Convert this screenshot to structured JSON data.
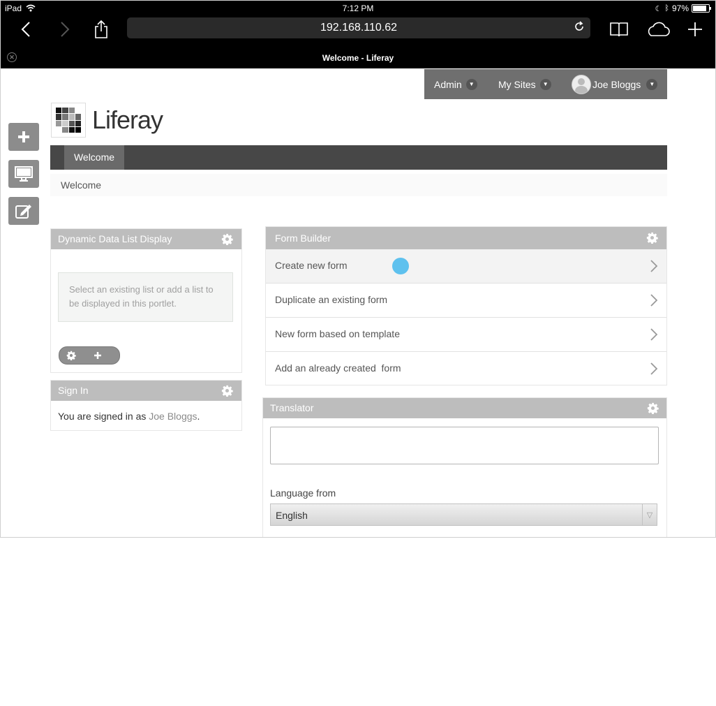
{
  "status": {
    "device": "iPad",
    "time": "7:12 PM",
    "battery": "97%"
  },
  "browser": {
    "url": "192.168.110.62",
    "tab_title": "Welcome - Liferay"
  },
  "dockbar": {
    "admin": "Admin",
    "my_sites": "My Sites",
    "user": "Joe Bloggs"
  },
  "site": {
    "name": "Liferay"
  },
  "nav": {
    "tabs": [
      {
        "label": "Welcome"
      }
    ]
  },
  "breadcrumb": {
    "current": "Welcome"
  },
  "ddl": {
    "title": "Dynamic Data List Display",
    "message": "Select an existing list or add a list to be displayed in this portlet."
  },
  "signin": {
    "title": "Sign In",
    "prefix": "You are signed in as ",
    "user": "Joe Bloggs",
    "suffix": "."
  },
  "form_builder": {
    "title": "Form Builder",
    "items": [
      {
        "label": "Create new form"
      },
      {
        "label": "Duplicate an existing form"
      },
      {
        "label": "New form based on template"
      },
      {
        "label": "Add an already created  form"
      }
    ]
  },
  "translator": {
    "title": "Translator",
    "input_value": "",
    "language_from_label": "Language from",
    "language_from_value": "English"
  },
  "colors": {
    "tap_indicator": "#5ec1ee",
    "dockbar": "#6f6f6f",
    "portlet_header": "#bdbdbd",
    "nav": "#474747"
  }
}
